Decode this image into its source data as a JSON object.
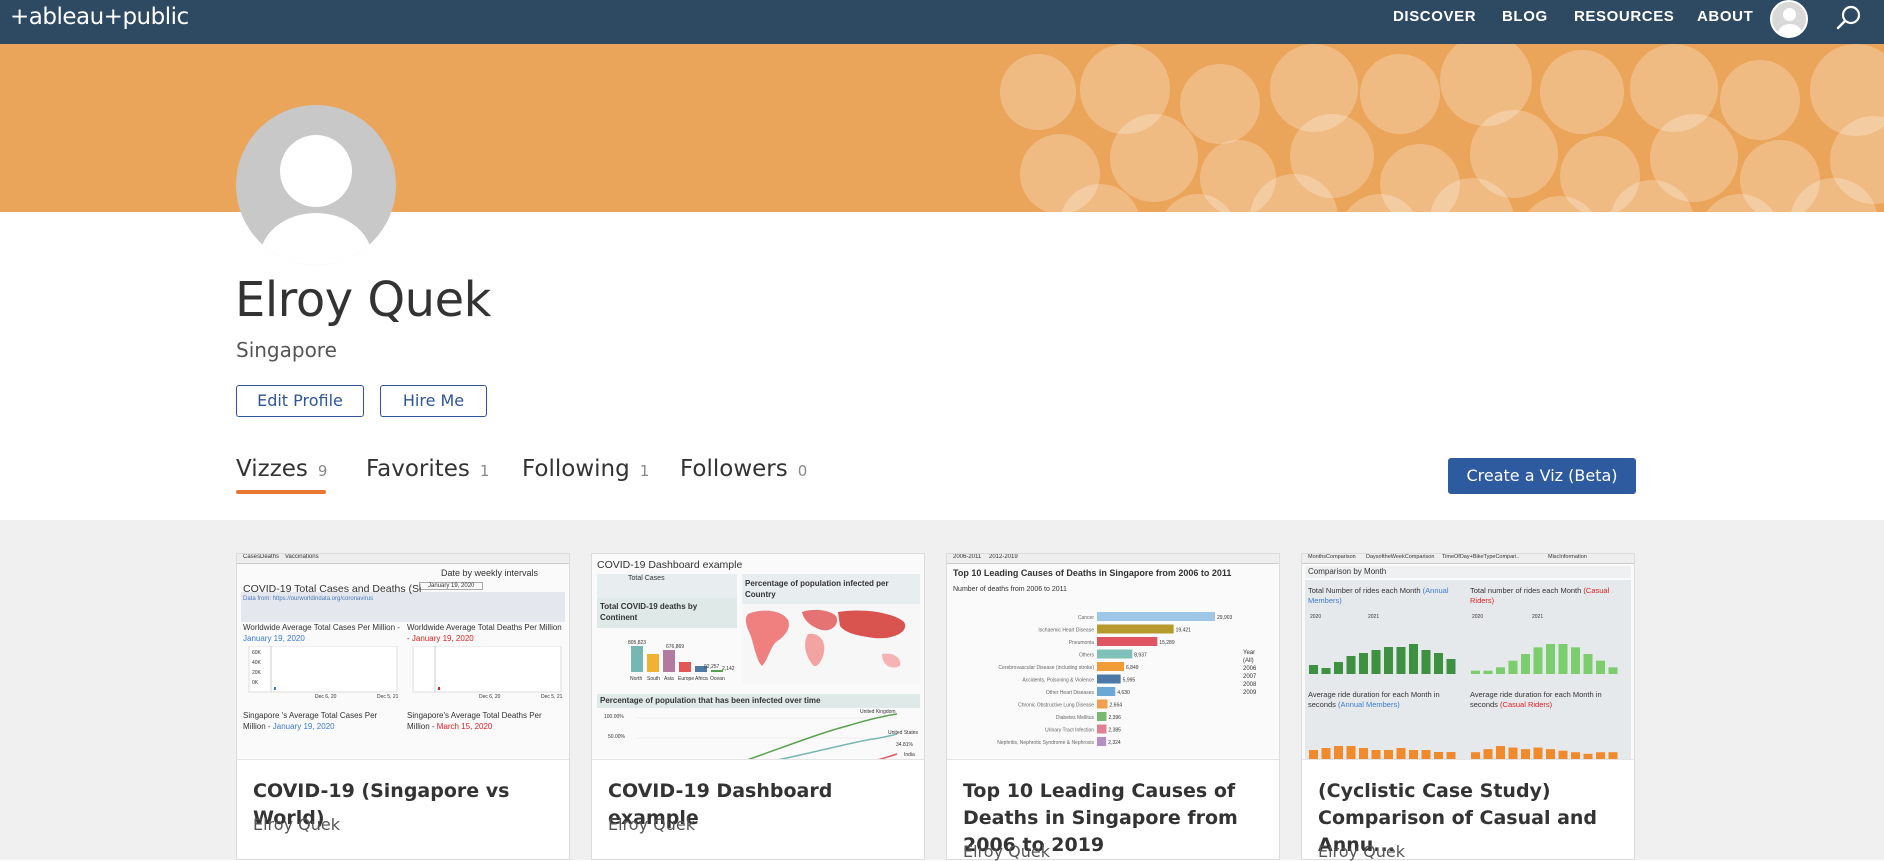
{
  "nav": {
    "logo": "+ableau+public",
    "links": [
      "DISCOVER",
      "BLOG",
      "RESOURCES",
      "ABOUT"
    ]
  },
  "profile": {
    "name": "Elroy Quek",
    "location": "Singapore",
    "edit_label": "Edit Profile",
    "hire_label": "Hire Me"
  },
  "tabs": [
    {
      "label": "Vizzes",
      "count": "9"
    },
    {
      "label": "Favorites",
      "count": "1"
    },
    {
      "label": "Following",
      "count": "1"
    },
    {
      "label": "Followers",
      "count": "0"
    }
  ],
  "create_label": "Create a Viz (Beta)",
  "colors": {
    "nav": "#2e4a63",
    "banner": "#eba55a",
    "accent": "#e8762c",
    "primary": "#2e5aa0"
  },
  "cards": [
    {
      "title": "COVID-19 (Singapore vs World)",
      "author": "Elroy Quek",
      "thumb": {
        "tabs": [
          "CasesDeaths",
          "Vaccinations"
        ],
        "date_label": "Date by weekly intervals",
        "date_value": "January 19, 2020",
        "heading": "COVID-19 Total Cases and Deaths (Si",
        "data_from": "Data from: https://ourworldindata.org/coronavirus",
        "p1_title": "Worldwide Average Total Cases Per Million - ",
        "p1_date": "January 19, 2020",
        "p2_title": "Worldwide Average Total Deaths Per Million - ",
        "p2_date": "January 19, 2020",
        "p3_title": "Singapore 's Average Total Cases Per Million - ",
        "p3_date": "January 19, 2020",
        "p4_title": "Singapore's Average Total Deaths Per Million - ",
        "p4_date": "March 15, 2020",
        "axis_ticks": [
          "60K",
          "40K",
          "20K",
          "0K"
        ],
        "x_ticks": [
          "Dec 6, 20",
          "Dec 5, 21"
        ]
      }
    },
    {
      "title": "COVID-19 Dashboard example",
      "author": "Elroy Quek",
      "thumb": {
        "heading": "COVID-19 Dashboard example",
        "total_cases": "Total Cases",
        "deaths_title": "Total COVID-19 deaths by Continent",
        "pop_title": "Percentage of population infected per Country",
        "infected_title": "Percentage of population that has been infected over time",
        "bar_labels": [
          "805,823",
          "676,869",
          "2,142",
          "92,257"
        ],
        "continents": [
          "North",
          "South",
          "Asia",
          "Europe",
          "Africa",
          "Ocean"
        ],
        "line_labels": [
          "United Kingdom",
          "United States",
          "34.81%",
          "India"
        ],
        "y_ticks": [
          "100.00%",
          "50.00%"
        ]
      }
    },
    {
      "title": "Top 10 Leading Causes of Deaths in Singapore from 2006 to 2019",
      "author": "Elroy Quek",
      "thumb": {
        "tabs": [
          "2006-2011",
          "2012-2019"
        ],
        "heading": "Top 10 Leading Causes of Deaths in Singapore from 2006 to 2011",
        "subheading": "Number of deaths from 2006 to 2011",
        "bars": [
          {
            "label": "Cancer",
            "value": 29903,
            "text": "29,903",
            "color": "#9ec6e6"
          },
          {
            "label": "Ischaemic Heart Disease",
            "value": 19421,
            "text": "19,421",
            "color": "#b79a2e"
          },
          {
            "label": "Pneumonia",
            "value": 15289,
            "text": "15,289",
            "color": "#e05563"
          },
          {
            "label": "Others",
            "value": 8937,
            "text": "8,937",
            "color": "#7fc1b8"
          },
          {
            "label": "Cerebrovascular Disease (including stroke)",
            "value": 6849,
            "text": "6,849",
            "color": "#f29c38"
          },
          {
            "label": "Accidents, Poisoning & Violence",
            "value": 5995,
            "text": "5,995",
            "color": "#4d79a8"
          },
          {
            "label": "Other Heart Diseases",
            "value": 4630,
            "text": "4,630",
            "color": "#6aa9d6"
          },
          {
            "label": "Chronic Obstructive Lung Disease",
            "value": 2664,
            "text": "2,664",
            "color": "#f0a050"
          },
          {
            "label": "Diabetes Mellitus",
            "value": 2396,
            "text": "2,396",
            "color": "#7ab870"
          },
          {
            "label": "Urinary Tract Infection",
            "value": 2385,
            "text": "2,385",
            "color": "#e08090"
          },
          {
            "label": "Nephritis, Nephrotic Syndrome & Nephrosis",
            "value": 2324,
            "text": "2,324",
            "color": "#b58fc3"
          }
        ],
        "legend_title": "Year",
        "legend_years": [
          "(All)",
          "2006",
          "2007",
          "2008",
          "2009"
        ]
      }
    },
    {
      "title": "(Cyclistic Case Study) Comparison of Casual and Annu...",
      "author": "Elroy Quek",
      "thumb": {
        "tabs": [
          "MonthsComparison",
          "DaysoftheWeekComparison",
          "TimeOfDay+BikeTypeCompari..",
          "MiscInformation"
        ],
        "heading": "Comparison by Month",
        "q1": "Total Number of rides each Month",
        "q1_tag": "(Annual Members)",
        "q2": "Total number of rides each Month",
        "q2_tag": "(Casual Riders)",
        "q3": "Average ride duration for each Month in seconds",
        "q3_tag": "(Annual Members)",
        "q4": "Average ride duration for each Month in seconds",
        "q4_tag": "(Casual Riders)",
        "years": [
          "2020",
          "2021"
        ],
        "member_rides": [
          3,
          2,
          4,
          6,
          7,
          8,
          9,
          9,
          10,
          8,
          7,
          5
        ],
        "casual_rides": [
          1,
          1,
          2,
          4,
          6,
          8,
          9,
          9,
          8,
          6,
          4,
          2
        ],
        "member_duration": [
          5,
          6,
          7,
          7,
          6,
          5,
          5,
          6,
          5,
          5,
          4,
          4
        ],
        "casual_duration": [
          5,
          7,
          9,
          8,
          7,
          8,
          7,
          6,
          5,
          4,
          5,
          5
        ]
      }
    }
  ]
}
